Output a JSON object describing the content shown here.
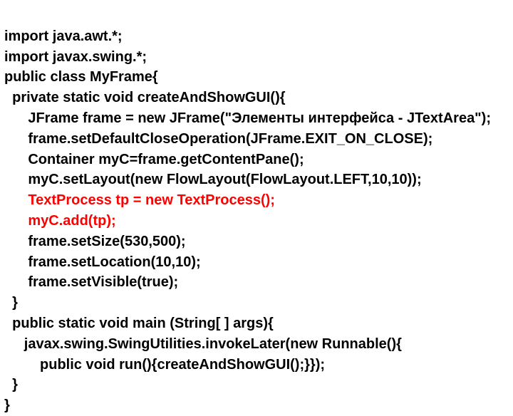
{
  "code": {
    "l1": "import java.awt.*;",
    "l2": "import javax.swing.*;",
    "l3": "public class MyFrame{",
    "l4": "  private static void createAndShowGUI(){",
    "l5": "      JFrame frame = new JFrame(\"Элементы интерфейса - JTextArea\");",
    "l6": "      frame.setDefaultCloseOperation(JFrame.EXIT_ON_CLOSE);",
    "l7": "      Container myC=frame.getContentPane();",
    "l8": "      myC.setLayout(new FlowLayout(FlowLayout.LEFT,10,10));",
    "l9": "      TextProcess tp = new TextProcess();",
    "l10": "      myC.add(tp);",
    "l11": "      frame.setSize(530,500);",
    "l12": "      frame.setLocation(10,10);",
    "l13": "      frame.setVisible(true);",
    "l14": "  }",
    "l15": "  public static void main (String[ ] args){",
    "l16": "     javax.swing.SwingUtilities.invokeLater(new Runnable(){",
    "l17": "         public void run(){createAndShowGUI();}});",
    "l18": "  }",
    "l19": "}"
  },
  "highlight_color": "#ff0000"
}
